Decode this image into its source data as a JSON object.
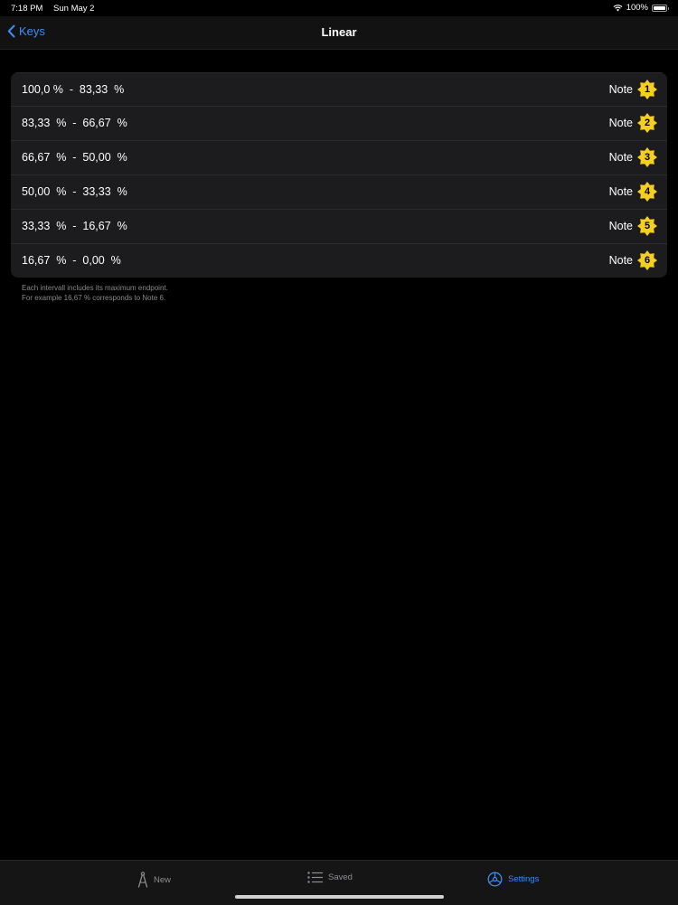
{
  "status_bar": {
    "time": "7:18 PM",
    "date": "Sun May 2",
    "battery": "100%",
    "icons": [
      "wifi-icon",
      "battery-icon"
    ]
  },
  "nav": {
    "back_label": "Keys",
    "title": "Linear",
    "back_icon": "chevron-left-icon"
  },
  "intervals": [
    {
      "range": "100,0 %  -  83,33  %",
      "note": "Note",
      "number": "1"
    },
    {
      "range": "83,33  %  -  66,67  %",
      "note": "Note",
      "number": "2"
    },
    {
      "range": "66,67  %  -  50,00  %",
      "note": "Note",
      "number": "3"
    },
    {
      "range": "50,00  %  -  33,33  %",
      "note": "Note",
      "number": "4"
    },
    {
      "range": "33,33  %  -  16,67  %",
      "note": "Note",
      "number": "5"
    },
    {
      "range": "16,67  %  -  0,00  %",
      "note": "Note",
      "number": "6"
    }
  ],
  "footnote": {
    "line1": "Each intervall includes its maximum endpoint.",
    "line2": "For example 16,67 % corresponds to Note 6."
  },
  "tab_bar": {
    "tabs": [
      {
        "label": "New",
        "icon": "compass-icon",
        "active": false
      },
      {
        "label": "Saved",
        "icon": "list-icon",
        "active": false
      },
      {
        "label": "Settings",
        "icon": "gear-icon",
        "active": true
      }
    ]
  },
  "colors": {
    "accent": "#3e8df5",
    "badge": "#f5cf1f",
    "background": "#000000",
    "card": "#1c1c1e"
  }
}
